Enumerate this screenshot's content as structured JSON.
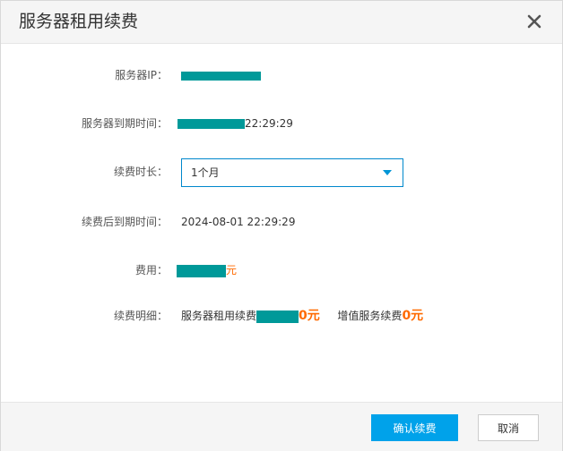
{
  "dialog": {
    "title": "服务器租用续费",
    "close_icon": "close-icon"
  },
  "form": {
    "server_ip": {
      "label": "服务器IP："
    },
    "expire_time": {
      "label": "服务器到期时间：",
      "value_suffix": "22:29:29"
    },
    "duration": {
      "label": "续费时长：",
      "selected": "1个月",
      "icon": "chevron-down-icon"
    },
    "new_expire_time": {
      "label": "续费后到期时间：",
      "value": "2024-08-01 22:29:29"
    },
    "fee": {
      "label": "费用：",
      "unit": "元"
    },
    "detail": {
      "label": "续费明细：",
      "rent_label": "服务器租用续费",
      "rent_amount_tail": "0元",
      "vas_label": "增值服务续费",
      "vas_amount": "0元"
    }
  },
  "footer": {
    "confirm_label": "确认续费",
    "cancel_label": "取消"
  },
  "colors": {
    "accent": "#00a2ea",
    "price": "#ff6a00",
    "redaction": "#009999"
  }
}
